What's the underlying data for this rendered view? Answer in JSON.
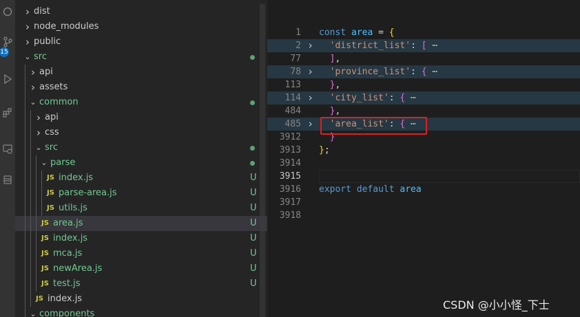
{
  "activity_bar": {
    "icons": [
      "circle-icon",
      "source-control-icon",
      "run-debug-icon",
      "extensions-icon",
      "remote-icon",
      "database-icon"
    ],
    "scm_badge": "15"
  },
  "explorer": {
    "rows": [
      {
        "label": "dist",
        "depth": 1,
        "chevron": "right",
        "status": "",
        "js": false,
        "green": false
      },
      {
        "label": "node_modules",
        "depth": 1,
        "chevron": "right",
        "status": "",
        "js": false,
        "green": false
      },
      {
        "label": "public",
        "depth": 1,
        "chevron": "right",
        "status": "",
        "js": false,
        "green": false
      },
      {
        "label": "src",
        "depth": 1,
        "chevron": "down",
        "status": "dot",
        "js": false,
        "green": true
      },
      {
        "label": "api",
        "depth": 2,
        "chevron": "right",
        "status": "",
        "js": false,
        "green": false
      },
      {
        "label": "assets",
        "depth": 2,
        "chevron": "right",
        "status": "",
        "js": false,
        "green": false
      },
      {
        "label": "common",
        "depth": 2,
        "chevron": "down",
        "status": "dot",
        "js": false,
        "green": true
      },
      {
        "label": "api",
        "depth": 3,
        "chevron": "right",
        "status": "",
        "js": false,
        "green": false
      },
      {
        "label": "css",
        "depth": 3,
        "chevron": "right",
        "status": "",
        "js": false,
        "green": false
      },
      {
        "label": "src",
        "depth": 3,
        "chevron": "down",
        "status": "dot",
        "js": false,
        "green": true
      },
      {
        "label": "parse",
        "depth": 4,
        "chevron": "down",
        "status": "dot",
        "js": false,
        "green": true
      },
      {
        "label": "index.js",
        "depth": 5,
        "chevron": "",
        "status": "U",
        "js": true,
        "green": true
      },
      {
        "label": "parse-area.js",
        "depth": 5,
        "chevron": "",
        "status": "U",
        "js": true,
        "green": true
      },
      {
        "label": "utils.js",
        "depth": 5,
        "chevron": "",
        "status": "U",
        "js": true,
        "green": true
      },
      {
        "label": "area.js",
        "depth": 4,
        "chevron": "",
        "status": "U",
        "js": true,
        "green": true,
        "selected": true
      },
      {
        "label": "index.js",
        "depth": 4,
        "chevron": "",
        "status": "U",
        "js": true,
        "green": true
      },
      {
        "label": "mca.js",
        "depth": 4,
        "chevron": "",
        "status": "U",
        "js": true,
        "green": true
      },
      {
        "label": "newArea.js",
        "depth": 4,
        "chevron": "",
        "status": "U",
        "js": true,
        "green": true
      },
      {
        "label": "test.js",
        "depth": 4,
        "chevron": "",
        "status": "U",
        "js": true,
        "green": true
      },
      {
        "label": "index.js",
        "depth": 3,
        "chevron": "",
        "status": "",
        "js": true,
        "green": false
      },
      {
        "label": "components",
        "depth": 2,
        "chevron": "down",
        "status": "",
        "js": false,
        "green": true
      }
    ],
    "js_badge": "JS"
  },
  "editor": {
    "lines": [
      {
        "num": "1",
        "fold": false,
        "folded": false,
        "tokens": [
          [
            "kw",
            "const "
          ],
          [
            "var",
            "area"
          ],
          [
            "txt",
            " = "
          ],
          [
            "b1",
            "{"
          ]
        ]
      },
      {
        "num": "2",
        "fold": true,
        "folded": true,
        "tokens": [
          [
            "txt",
            "  "
          ],
          [
            "str",
            "'district_list'"
          ],
          [
            "txt",
            ": "
          ],
          [
            "b2",
            "["
          ],
          [
            "ell",
            " ⋯"
          ]
        ]
      },
      {
        "num": "77",
        "fold": false,
        "folded": false,
        "tokens": [
          [
            "txt",
            "  "
          ],
          [
            "b2",
            "]"
          ],
          [
            "txt",
            ","
          ]
        ]
      },
      {
        "num": "78",
        "fold": true,
        "folded": true,
        "tokens": [
          [
            "txt",
            "  "
          ],
          [
            "str",
            "'province_list'"
          ],
          [
            "txt",
            ": "
          ],
          [
            "b2",
            "{"
          ],
          [
            "ell",
            " ⋯"
          ]
        ]
      },
      {
        "num": "113",
        "fold": false,
        "folded": false,
        "tokens": [
          [
            "txt",
            "  "
          ],
          [
            "b2",
            "}"
          ],
          [
            "txt",
            ","
          ]
        ]
      },
      {
        "num": "114",
        "fold": true,
        "folded": true,
        "tokens": [
          [
            "txt",
            "  "
          ],
          [
            "str",
            "'city_list'"
          ],
          [
            "txt",
            ": "
          ],
          [
            "b2",
            "{"
          ],
          [
            "ell",
            " ⋯"
          ]
        ]
      },
      {
        "num": "484",
        "fold": false,
        "folded": false,
        "tokens": [
          [
            "txt",
            "  "
          ],
          [
            "b2",
            "}"
          ],
          [
            "txt",
            ","
          ]
        ]
      },
      {
        "num": "485",
        "fold": true,
        "folded": true,
        "tokens": [
          [
            "txt",
            "  "
          ],
          [
            "str",
            "'area_list'"
          ],
          [
            "txt",
            ": "
          ],
          [
            "b2",
            "{"
          ],
          [
            "ell",
            " ⋯"
          ]
        ]
      },
      {
        "num": "3912",
        "fold": false,
        "folded": false,
        "tokens": [
          [
            "txt",
            "  "
          ],
          [
            "b2",
            "}"
          ]
        ]
      },
      {
        "num": "3913",
        "fold": false,
        "folded": false,
        "tokens": [
          [
            "b1",
            "}"
          ],
          [
            "txt",
            ";"
          ]
        ]
      },
      {
        "num": "3914",
        "fold": false,
        "folded": false,
        "tokens": []
      },
      {
        "num": "3915",
        "fold": false,
        "folded": false,
        "active": true,
        "tokens": []
      },
      {
        "num": "3916",
        "fold": false,
        "folded": false,
        "tokens": [
          [
            "kw",
            "export default "
          ],
          [
            "var",
            "area"
          ]
        ]
      },
      {
        "num": "3917",
        "fold": false,
        "folded": false,
        "tokens": []
      },
      {
        "num": "3918",
        "fold": false,
        "folded": false,
        "tokens": []
      }
    ]
  },
  "watermark": "CSDN @小小怪_下士",
  "colors": {
    "accent": "#0e70c0",
    "untracked": "#73c991",
    "annotation": "#e02020"
  }
}
